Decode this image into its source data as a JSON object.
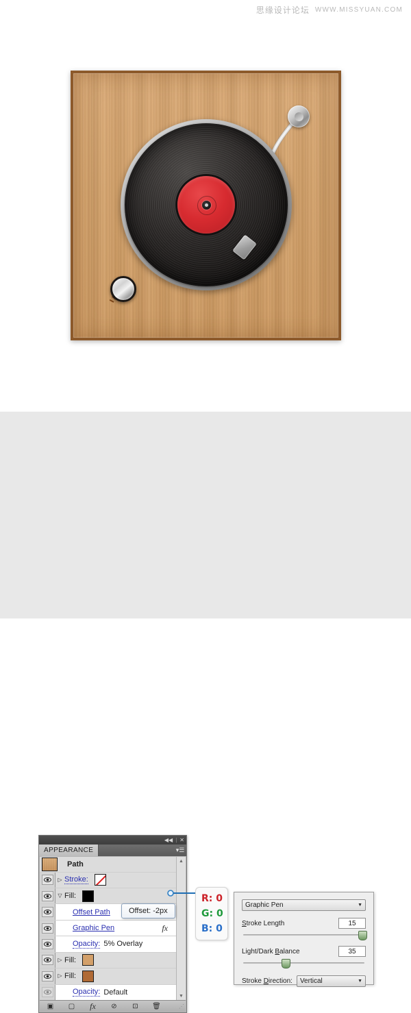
{
  "watermark": {
    "cn_text": "思缘设计论坛",
    "url_text": "WWW.MISSYUAN.COM"
  },
  "artwork": {
    "name": "vinyl-turntable-illustration",
    "board_color": "#d5a269",
    "board_border_color": "#8d5a2b",
    "record_color": "#1e1c1b",
    "record_label_color": "#d72b30",
    "platter_color": "#b9b9b9",
    "tonearm_color": "#c9c9c9",
    "knob_color": "#d8d8d8",
    "tick_color": "#7c4518",
    "tick_hot_color": "#c4381c"
  },
  "panel": {
    "titlebar": {
      "collapse_label": "◀◀",
      "separator": "|",
      "close_label": "✕"
    },
    "tab_label": "APPEARANCE",
    "menu_icon_label": "▾☰",
    "object_row": {
      "thumbnail_name": "path-thumbnail",
      "title": "Path"
    },
    "rows": [
      {
        "name": "stroke",
        "eye": "visible",
        "triangle": "▷",
        "label": "Stroke:",
        "label_style": "link-dotted",
        "swatch": "none",
        "shaded": true
      },
      {
        "name": "fill-top",
        "eye": "visible",
        "triangle": "▽",
        "label": "Fill:",
        "label_style": "plain",
        "swatch": "#000000",
        "shaded": true
      },
      {
        "name": "offset-path",
        "eye": "visible",
        "triangle": "",
        "label": "Offset Path",
        "label_style": "link",
        "shaded": false
      },
      {
        "name": "graphic-pen",
        "eye": "visible",
        "triangle": "",
        "label": "Graphic Pen",
        "label_style": "link",
        "fx": "fx",
        "shaded": false
      },
      {
        "name": "opacity-overlay",
        "eye": "visible",
        "triangle": "",
        "label": "Opacity:",
        "label_style": "link-dotted",
        "value": "5% Overlay",
        "shaded": false
      },
      {
        "name": "fill-tan",
        "eye": "visible",
        "triangle": "▷",
        "label": "Fill:",
        "label_style": "plain",
        "swatch": "#d3a06a",
        "shaded": true
      },
      {
        "name": "fill-brown",
        "eye": "visible",
        "triangle": "▷",
        "label": "Fill:",
        "label_style": "plain",
        "swatch": "#b06a35",
        "shaded": true
      },
      {
        "name": "opacity-default",
        "eye": "dimmed",
        "triangle": "",
        "label": "Opacity:",
        "label_style": "link-dotted",
        "value": "Default",
        "shaded": false
      }
    ],
    "scrollbar": {
      "up_arrow": "▲",
      "down_arrow": "▼"
    },
    "footer_buttons": [
      {
        "name": "add-new-stroke-button",
        "glyph": "▣"
      },
      {
        "name": "add-new-fill-button",
        "glyph": "▢"
      },
      {
        "name": "add-new-effect-button",
        "glyph": "fx"
      },
      {
        "name": "clear-appearance-button",
        "glyph": "⊘"
      },
      {
        "name": "duplicate-selected-item-button",
        "glyph": "⊡"
      },
      {
        "name": "delete-selected-item-button",
        "glyph": "🗑"
      }
    ],
    "footer_grip": "⋰"
  },
  "tooltip": {
    "text": "Offset: -2px"
  },
  "rgb_callout": {
    "r_label": "R: 0",
    "g_label": "G: 0",
    "b_label": "B: 0",
    "r_color": "#cc2229",
    "g_color": "#1f9a3c",
    "b_color": "#2a6fc9"
  },
  "graphic_pen_dialog": {
    "effect_name": "Graphic Pen",
    "caret": "▼",
    "stroke_length": {
      "label_pre": "S",
      "label_post": "troke Length",
      "value": "15",
      "slider_percent": 96
    },
    "light_dark_balance": {
      "label_pre": "Light/Dark ",
      "label_mid": "B",
      "label_post": "alance",
      "value": "35",
      "slider_percent": 34
    },
    "stroke_direction": {
      "label_pre": "Stroke ",
      "label_mid": "D",
      "label_post": "irection:",
      "value": "Vertical"
    }
  }
}
